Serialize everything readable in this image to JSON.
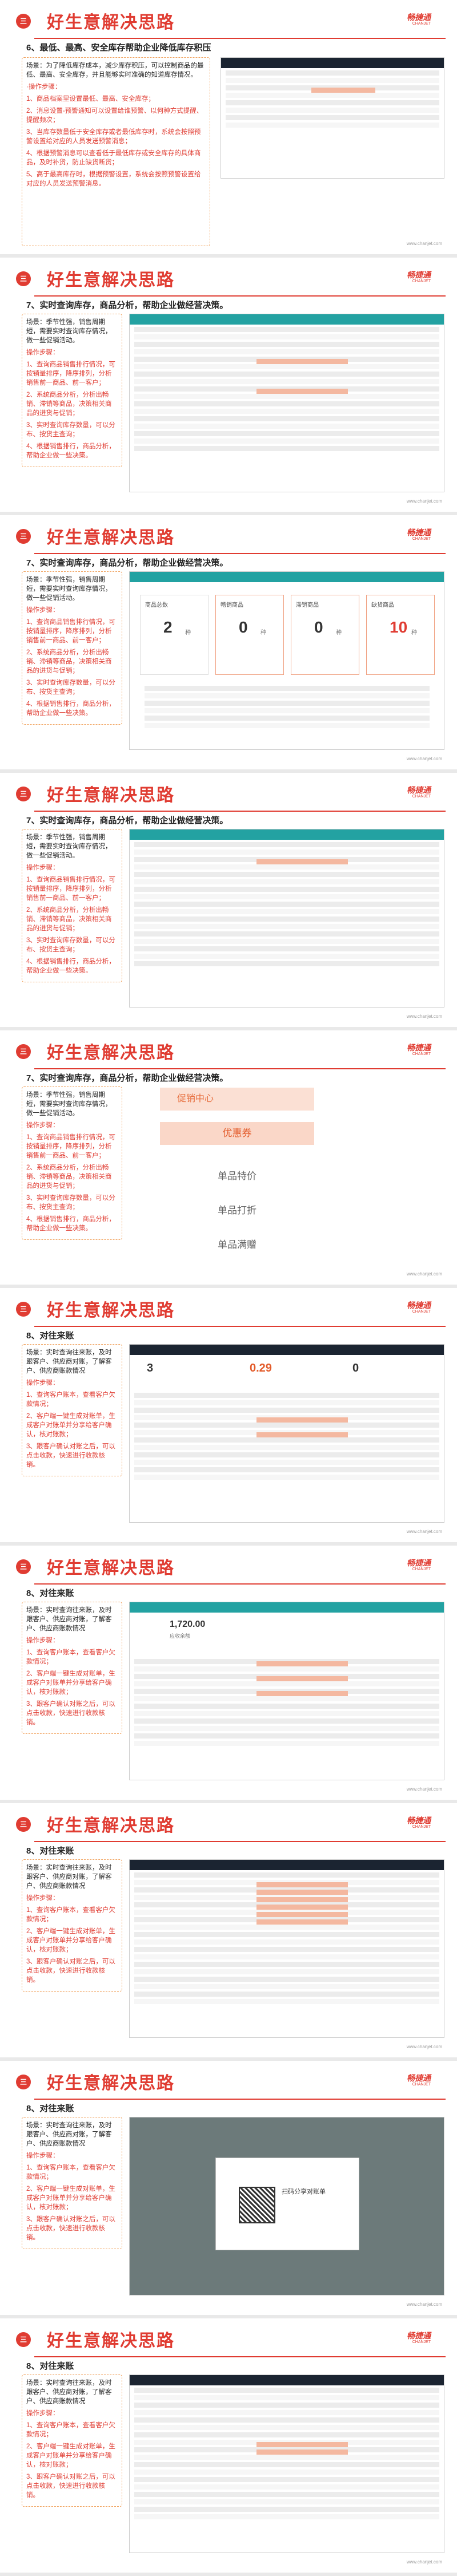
{
  "brand": {
    "name": "畅捷通",
    "tagline": "CHANJET",
    "phone": "4006-600-566"
  },
  "footer_url": "www.chanjet.com",
  "slides": [
    {
      "badge": "三",
      "title": "好生意解决思路",
      "subtitle": "6、最低、最高、安全库存帮助企业降低库存积压",
      "paragraphs": [
        "场景：为了降低库存成本，减少库存积压，可以控制商品的最低、最高、安全库存，并且能够实时准确的知道库存情况。",
        "·操作步骤：",
        "1、商品档案里设置最低、最高、安全库存；",
        "2、消息设置-预警通知可以设置给谁预警、以何种方式提醒、提醒频次；",
        "3、当库存数量低于安全库存或者最低库存时，系统会按照预警设置给对应的人员发送预警消息；",
        "4、根据预警消息可以查看低于最低库存或安全库存的具体商品，及时补货，防止缺货断货；",
        "5、高于最高库存时，根据预警设置，系统会按照预警设置给对应的人员发送预警消息。"
      ]
    },
    {
      "badge": "三",
      "title": "好生意解决思路",
      "subtitle": "7、实时查询库存，商品分析，帮助企业做经营决策。",
      "paragraphs": [
        "场景：季节性强，销售周期短，需要实时查询库存情况，做一些促销活动。",
        "操作步骤：",
        "1、查询商品销售排行情况，可按销量排序，降序排列，分析销售前一商品、前一客户；",
        "2、系统商品分析，分析出畅销、滞销等商品，决策相关商品的进货与促销；",
        "3、实时查询库存数量，可以分布、按货主查询；",
        "4、根据销售排行，商品分析，帮助企业做一些决策。"
      ]
    },
    {
      "badge": "三",
      "title": "好生意解决思路",
      "subtitle": "7、实时查询库存，商品分析，帮助企业做经营决策。",
      "paragraphs": [
        "场景：季节性强，销售周期短，需要实时查询库存情况，做一些促销活动。",
        "操作步骤：",
        "1、查询商品销售排行情况，可按销量排序，降序排列，分析销售前一商品、前一客户；",
        "2、系统商品分析，分析出畅销、滞销等商品，决策相关商品的进货与促销；",
        "3、实时查询库存数量，可以分布、按货主查询；",
        "4、根据销售排行，商品分析，帮助企业做一些决策。"
      ],
      "cards": [
        {
          "label": "商品总数",
          "value": "2",
          "unit": "种"
        },
        {
          "label": "畅销商品",
          "value": "0",
          "unit": "种"
        },
        {
          "label": "滞销商品",
          "value": "0",
          "unit": "种"
        },
        {
          "label": "缺货商品",
          "value": "10",
          "unit": "种"
        }
      ]
    },
    {
      "badge": "三",
      "title": "好生意解决思路",
      "subtitle": "7、实时查询库存，商品分析，帮助企业做经营决策。",
      "paragraphs": [
        "场景：季节性强，销售周期短，需要实时查询库存情况，做一些促销活动。",
        "操作步骤：",
        "1、查询商品销售排行情况，可按销量排序，降序排列，分析销售前一商品、前一客户；",
        "2、系统商品分析，分析出畅销、滞销等商品，决策相关商品的进货与促销；",
        "3、实时查询库存数量，可以分布、按货主查询；",
        "4、根据销售排行，商品分析，帮助企业做一些决策。"
      ]
    },
    {
      "badge": "三",
      "title": "好生意解决思路",
      "subtitle": "7、实时查询库存，商品分析，帮助企业做经营决策。",
      "paragraphs": [
        "场景：季节性强，销售周期短，需要实时查询库存情况，做一些促销活动。",
        "操作步骤：",
        "1、查询商品销售排行情况，可按销量排序，降序排列，分析销售前一商品、前一客户；",
        "2、系统商品分析，分析出畅销、滞销等商品，决策相关商品的进货与促销；",
        "3、实时查询库存数量，可以分布、按货主查询；",
        "4、根据销售排行，商品分析，帮助企业做一些决策。"
      ],
      "menu": {
        "head": "促销中心",
        "active": "优惠券",
        "items": [
          "单品特价",
          "单品打折",
          "单品满赠"
        ]
      }
    },
    {
      "badge": "三",
      "title": "好生意解决思路",
      "subtitle": "8、对往来账",
      "paragraphs": [
        "场景：实时查询往来账，及时跟客户、供应商对账，了解客户、供应商账款情况",
        "操作步骤：",
        "1、查询客户账本，查看客户欠款情况；",
        "2、客户端一键生成对账单，生成客户对账单并分享给客户确认，核对账款；",
        "3、跟客户确认对账之后，可以点击收款，快速进行收款核销。"
      ],
      "stats": [
        {
          "value": "3"
        },
        {
          "value": "0.29"
        },
        {
          "value": "0"
        }
      ]
    },
    {
      "badge": "三",
      "title": "好生意解决思路",
      "subtitle": "8、对往来账",
      "paragraphs": [
        "场景：实时查询往来账，及时跟客户、供应商对账，了解客户、供应商账款情况",
        "操作步骤：",
        "1、查询客户账本，查看客户欠款情况；",
        "2、客户端一键生成对账单，生成客户对账单并分享给客户确认，核对账款；",
        "3、跟客户确认对账之后，可以点击收款，快速进行收款核销。"
      ],
      "balance": {
        "value": "1,720.00",
        "label": "应收余额"
      }
    },
    {
      "badge": "三",
      "title": "好生意解决思路",
      "subtitle": "8、对往来账",
      "paragraphs": [
        "场景：实时查询往来账，及时跟客户、供应商对账，了解客户、供应商账款情况",
        "操作步骤：",
        "1、查询客户账本，查看客户欠款情况；",
        "2、客户端一键生成对账单，生成客户对账单并分享给客户确认，核对账款；",
        "3、跟客户确认对账之后，可以点击收款，快速进行收款核销。"
      ]
    },
    {
      "badge": "三",
      "title": "好生意解决思路",
      "subtitle": "8、对往来账",
      "paragraphs": [
        "场景：实时查询往来账，及时跟客户、供应商对账，了解客户、供应商账款情况",
        "操作步骤：",
        "1、查询客户账本，查看客户欠款情况；",
        "2、客户端一键生成对账单，生成客户对账单并分享给客户确认，核对账款；",
        "3、跟客户确认对账之后，可以点击收款，快速进行收款核销。"
      ],
      "modal_title": "扫码分享对账单"
    },
    {
      "badge": "三",
      "title": "好生意解决思路",
      "subtitle": "8、对往来账",
      "paragraphs": [
        "场景：实时查询往来账，及时跟客户、供应商对账，了解客户、供应商账款情况",
        "操作步骤：",
        "1、查询客户账本，查看客户欠款情况；",
        "2、客户端一键生成对账单，生成客户对账单并分享给客户确认，核对账款；",
        "3、跟客户确认对账之后，可以点击收款，快速进行收款核销。"
      ]
    }
  ]
}
